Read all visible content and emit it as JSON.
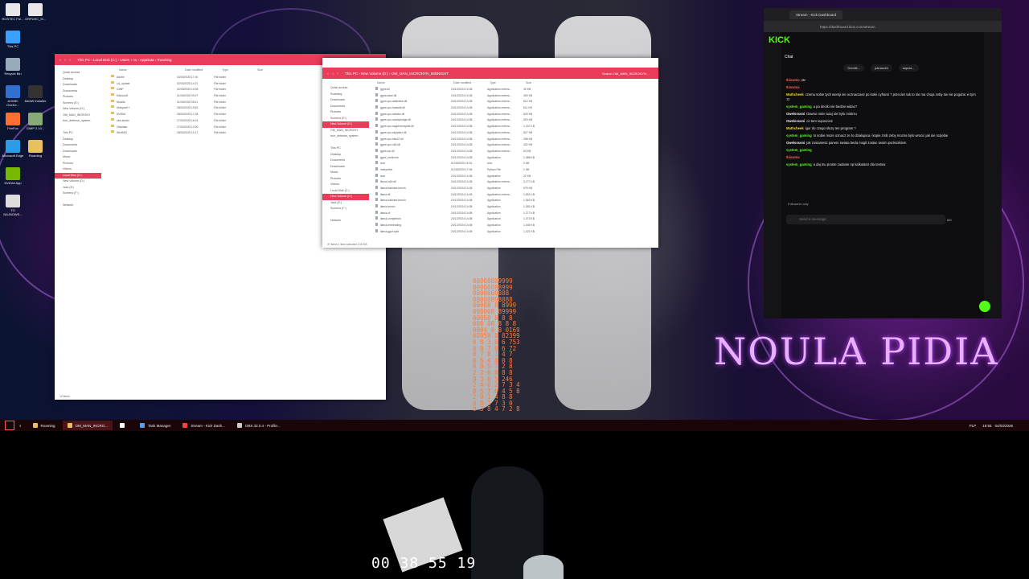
{
  "desktop": {
    "icons": [
      "This PC",
      "Recycle Bin",
      "AOMEI OneKe...",
      "Microsoft Edge",
      "NVIDIA App",
      "TO NAJNOWS...",
      "ROSTEC Fre...",
      "ORPUSC_M...",
      "MedW Installer",
      "GIMP 2.10...",
      "Roaming",
      "OM...",
      "FireFox"
    ],
    "wallpaper_text": "NOULA PIDIA",
    "digit_rain": [
      "00008889999",
      "00000088999",
      "0000008888",
      "00000898888",
      "00008 8 8999",
      "000008 89999",
      "00058 8 8 8",
      "000 00 8 8 8",
      "0004 8 8 0169",
      "00058 8 82399",
      "0 8 3 8 6 753",
      "0 8 7 8 6 72",
      "0 7 8 1 4 7",
      "0 6 4 8 0 8",
      "0 8 5 7 2 8",
      "2 2 0 8 8 8",
      "0 3 8 5 246",
      "2 4 0 2 7 3 4",
      "0 5 7 0 4 5 8",
      "2 0 1 4 8 8",
      "0 8 1 7 3 0",
      "0 3 8 4 7 2 8"
    ]
  },
  "explorer_left": {
    "breadcrumb": "This PC › Local Disk (C:) › Users › nu › AppData › Roaming",
    "columns": [
      "Name",
      "Date modified",
      "Type",
      "Size"
    ],
    "nav": [
      "Quick access",
      "Desktop",
      "Downloads",
      "Documents",
      "Pictures",
      "Screens (E:)",
      "New Volume (D:)",
      "OM_MAN_INCRONY",
      "true_defense_system",
      "",
      "This PC",
      "Desktop",
      "Documents",
      "Downloads",
      "Music",
      "Pictures",
      "Videos",
      "Local Disk (C:)",
      "New Volume (D:)",
      "Jack (E:)",
      "Screens (F:)",
      "",
      "Network"
    ],
    "selected_nav": "Local Disk (C:)",
    "rows": [
      {
        "name": "Adobe",
        "date": "03/03/2025 17:40",
        "type": "File folder"
      },
      {
        "name": "LA_update",
        "date": "02/03/2025 14:21",
        "type": "File folder"
      },
      {
        "name": "GIMP",
        "date": "02/03/2025 10:05",
        "type": "File folder"
      },
      {
        "name": "Microsoft",
        "date": "01/03/2025 09:27",
        "type": "File folder"
      },
      {
        "name": "Mozilla",
        "date": "01/03/2025 08:11",
        "type": "File folder"
      },
      {
        "name": "Notepad++",
        "date": "28/02/2025 19:52",
        "type": "File folder"
      },
      {
        "name": "NVIDIA",
        "date": "28/02/2025 17:34",
        "type": "File folder"
      },
      {
        "name": "obs-studio",
        "date": "27/02/2025 16:24",
        "type": "File folder"
      },
      {
        "name": "Obsidian",
        "date": "27/02/2025 12:00",
        "type": "File folder"
      },
      {
        "name": "WinRAR",
        "date": "26/02/2025 11:47",
        "type": "File folder"
      }
    ],
    "status": "10 items"
  },
  "explorer_right": {
    "breadcrumb": "This PC › New Volume (D:) › OM_MAN_INCRONYN_MIDNIGHT",
    "search_placeholder": "Search OM_MAN_INCRONYN...",
    "columns": [
      "Name",
      "Date modified",
      "Type",
      "Size"
    ],
    "nav": [
      "Quick access",
      "Roaming",
      "Downloads",
      "Documents",
      "Pictures",
      "Screens (E:)",
      "New Volume (D:)",
      "OM_MAN_INCRONY",
      "true_defense_system",
      "",
      "This PC",
      "Desktop",
      "Documents",
      "Downloads",
      "Music",
      "Pictures",
      "Videos",
      "Local Disk (C:)",
      "New Volume (D:)",
      "Jack (E:)",
      "Screens (F:)",
      "",
      "Network"
    ],
    "selected_nav": "New Volume (D:)",
    "rows": [
      {
        "name": "ggml.dll",
        "date": "24/12/2024 14:08",
        "type": "Application extens...",
        "size": "49 KB"
      },
      {
        "name": "ggml-base.dll",
        "date": "24/12/2024 14:08",
        "type": "Application extens...",
        "size": "490 KB"
      },
      {
        "name": "ggml-cpu-alderlake.dll",
        "date": "24/12/2024 14:08",
        "type": "Application extens...",
        "size": "512 KB"
      },
      {
        "name": "ggml-cpu-haswell.dll",
        "date": "24/12/2024 14:08",
        "type": "Application extens...",
        "size": "511 KB"
      },
      {
        "name": "ggml-cpu-icelake.dll",
        "date": "24/12/2024 14:08",
        "type": "Application extens...",
        "size": "529 KB"
      },
      {
        "name": "ggml-cpu-sandybridge.dll",
        "date": "24/12/2024 14:08",
        "type": "Application extens...",
        "size": "503 KB"
      },
      {
        "name": "ggml-cpu-sapphirerapids.dll",
        "date": "24/12/2024 14:08",
        "type": "Application extens...",
        "size": "1,347 KB"
      },
      {
        "name": "ggml-cpu-skylakex.dll",
        "date": "24/12/2024 14:08",
        "type": "Application extens...",
        "size": "527 KB"
      },
      {
        "name": "ggml-cpu-sse42.dll",
        "date": "24/12/2024 14:08",
        "type": "Application extens...",
        "size": "398 KB"
      },
      {
        "name": "ggml-cpu-x64.dll",
        "date": "24/12/2024 14:08",
        "type": "Application extens...",
        "size": "402 KB"
      },
      {
        "name": "ggml-rpc.dll",
        "date": "24/12/2024 14:08",
        "type": "Application extens...",
        "size": "53 KB"
      },
      {
        "name": "ggml_multi.exe",
        "date": "24/12/2024 14:08",
        "type": "Application",
        "size": "1,088 KB"
      },
      {
        "name": "icon",
        "date": "01/03/2025 15:31",
        "type": "Icon",
        "size": "2 KB"
      },
      {
        "name": "interpreter",
        "date": "01/03/2025 17:06",
        "type": "Python File",
        "size": "1 KB"
      },
      {
        "name": "lauv",
        "date": "24/12/2024 14:08",
        "type": "Application",
        "size": "22 KB"
      },
      {
        "name": "libcurl-x64.dll",
        "date": "24/12/2024 14:08",
        "type": "Application extens...",
        "size": "3,277 KB"
      },
      {
        "name": "llama-batched-bench",
        "date": "24/12/2024 14:08",
        "type": "Application",
        "size": "975 KB"
      },
      {
        "name": "llama.dll",
        "date": "24/12/2024 14:08",
        "type": "Application extens...",
        "size": "1,551 KB"
      },
      {
        "name": "llama-batched-bench",
        "date": "24/12/2024 14:08",
        "type": "Application",
        "size": "1,062 KB"
      },
      {
        "name": "llama-bench",
        "date": "24/12/2024 14:08",
        "type": "Application",
        "size": "1,081 KB"
      },
      {
        "name": "llama-cli",
        "date": "24/12/2024 14:08",
        "type": "Application",
        "size": "1,277 KB"
      },
      {
        "name": "llama-completion",
        "date": "24/12/2024 14:08",
        "type": "Application",
        "size": "1,073 KB"
      },
      {
        "name": "llama-embedding",
        "date": "24/12/2024 14:08",
        "type": "Application",
        "size": "1,045 KB"
      },
      {
        "name": "llama-gguf-split",
        "date": "24/12/2024 14:08",
        "type": "Application",
        "size": "1,021 KB"
      }
    ],
    "status": "47 items    1 item selected  1,00 KB"
  },
  "browser": {
    "tab_title": "Stream - Kick Dashboard",
    "url": "https://dashboard.kick.com/stream",
    "logo": "KICK",
    "chat_title": "Chat",
    "pinned_users": [
      "Domiik...",
      "panaszkii",
      "sapcia..."
    ],
    "messages": [
      {
        "user": "Ibiswnia",
        "text": "otc",
        "color": "#ff5a5a"
      },
      {
        "user": "Ibiswnia",
        "text": "",
        "color": "#ff5a5a"
      },
      {
        "user": "Mathcheek",
        "text": "czemu sobie tych wersji nie ocznaczasz po kolei cyframi ? przeciez tak to nie ma chuja zeby sie nie pogubic w tym :D",
        "color": "#f5d442"
      },
      {
        "user": "system_gaming",
        "text": "a po deciki nie bedzie widac?",
        "color": "#53fc18"
      },
      {
        "user": "Owelsssoni",
        "text": "Dawno mnie tutaj nie bylo mistrzu",
        "color": "#f0f0f0"
      },
      {
        "user": "Owelsssoni",
        "text": "co tam suponciez",
        "color": "#f0f0f0"
      },
      {
        "user": "Mathcheek",
        "text": "igor do czego sluzy ten program ?",
        "color": "#f5d442"
      },
      {
        "user": "system_gaming",
        "text": "to sobie moze oznacz ze to dzialajaca i kopie zrob zeby mozna bylo wrocic jak sie rozjebie",
        "color": "#53fc18"
      },
      {
        "user": "Owelsssoni",
        "text": "jak zostaniesz panem swiata beda mogli zostac twoim podnozkiem",
        "color": "#f0f0f0"
      },
      {
        "user": "system_gaming",
        "text": "",
        "color": "#53fc18"
      },
      {
        "user": "Ibiswnia",
        "text": "",
        "color": "#ff5a5a"
      },
      {
        "user": "system_gaming",
        "text": "a daj mu proste zadanie np kalkulator dla testow",
        "color": "#53fc18"
      }
    ],
    "followers_only": "Followers only",
    "input_placeholder": "Send a message",
    "counter": "0/0"
  },
  "taskbar": {
    "items": [
      {
        "label": "Roaming",
        "color": "#e8c060"
      },
      {
        "label": "OM_MAN_INCRO...",
        "color": "#e8c060"
      },
      {
        "label": "",
        "color": "#ffffff"
      },
      {
        "label": "Task Manager",
        "color": "#53a0f0"
      },
      {
        "label": "Stream - Kick Dash...",
        "color": "#ff4040"
      },
      {
        "label": "OBS 32.0.4 - Profile...",
        "color": "#cccccc"
      }
    ],
    "lang": "PLP",
    "time": "18:55",
    "date": "04/03/2026"
  },
  "webcam": {
    "timestamp": "00 38 55 19"
  }
}
